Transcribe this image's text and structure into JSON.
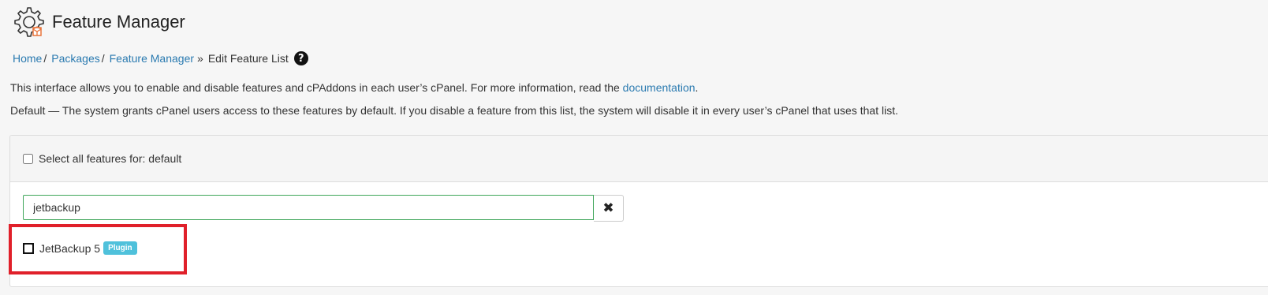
{
  "header": {
    "title": "Feature Manager",
    "icon": "feature-manager-gear-icon",
    "accent_color": "#e8733a"
  },
  "breadcrumb": {
    "items": [
      {
        "label": "Home",
        "separator": "/"
      },
      {
        "label": "Packages",
        "separator": "/"
      },
      {
        "label": "Feature Manager",
        "separator": "»"
      }
    ],
    "current": "Edit Feature List",
    "help_icon": "question-circle-icon"
  },
  "description": {
    "line1_prefix": "This interface allows you to enable and disable features and cPAddons in each user’s cPanel. For more information, read the ",
    "line1_link": "documentation",
    "line1_suffix": ".",
    "line2": "Default — The system grants cPanel users access to these features by default. If you disable a feature from this list, the system will disable it in every user’s cPanel that uses that list."
  },
  "panel": {
    "select_all_label": "Select all features for: default",
    "search": {
      "value": "jetbackup",
      "clear_icon": "close-icon"
    },
    "features": [
      {
        "label": "JetBackup 5",
        "badge": "Plugin",
        "badge_color": "#4fc1db",
        "checked": false
      }
    ]
  },
  "annotation": {
    "highlight_color": "#e0202a"
  }
}
